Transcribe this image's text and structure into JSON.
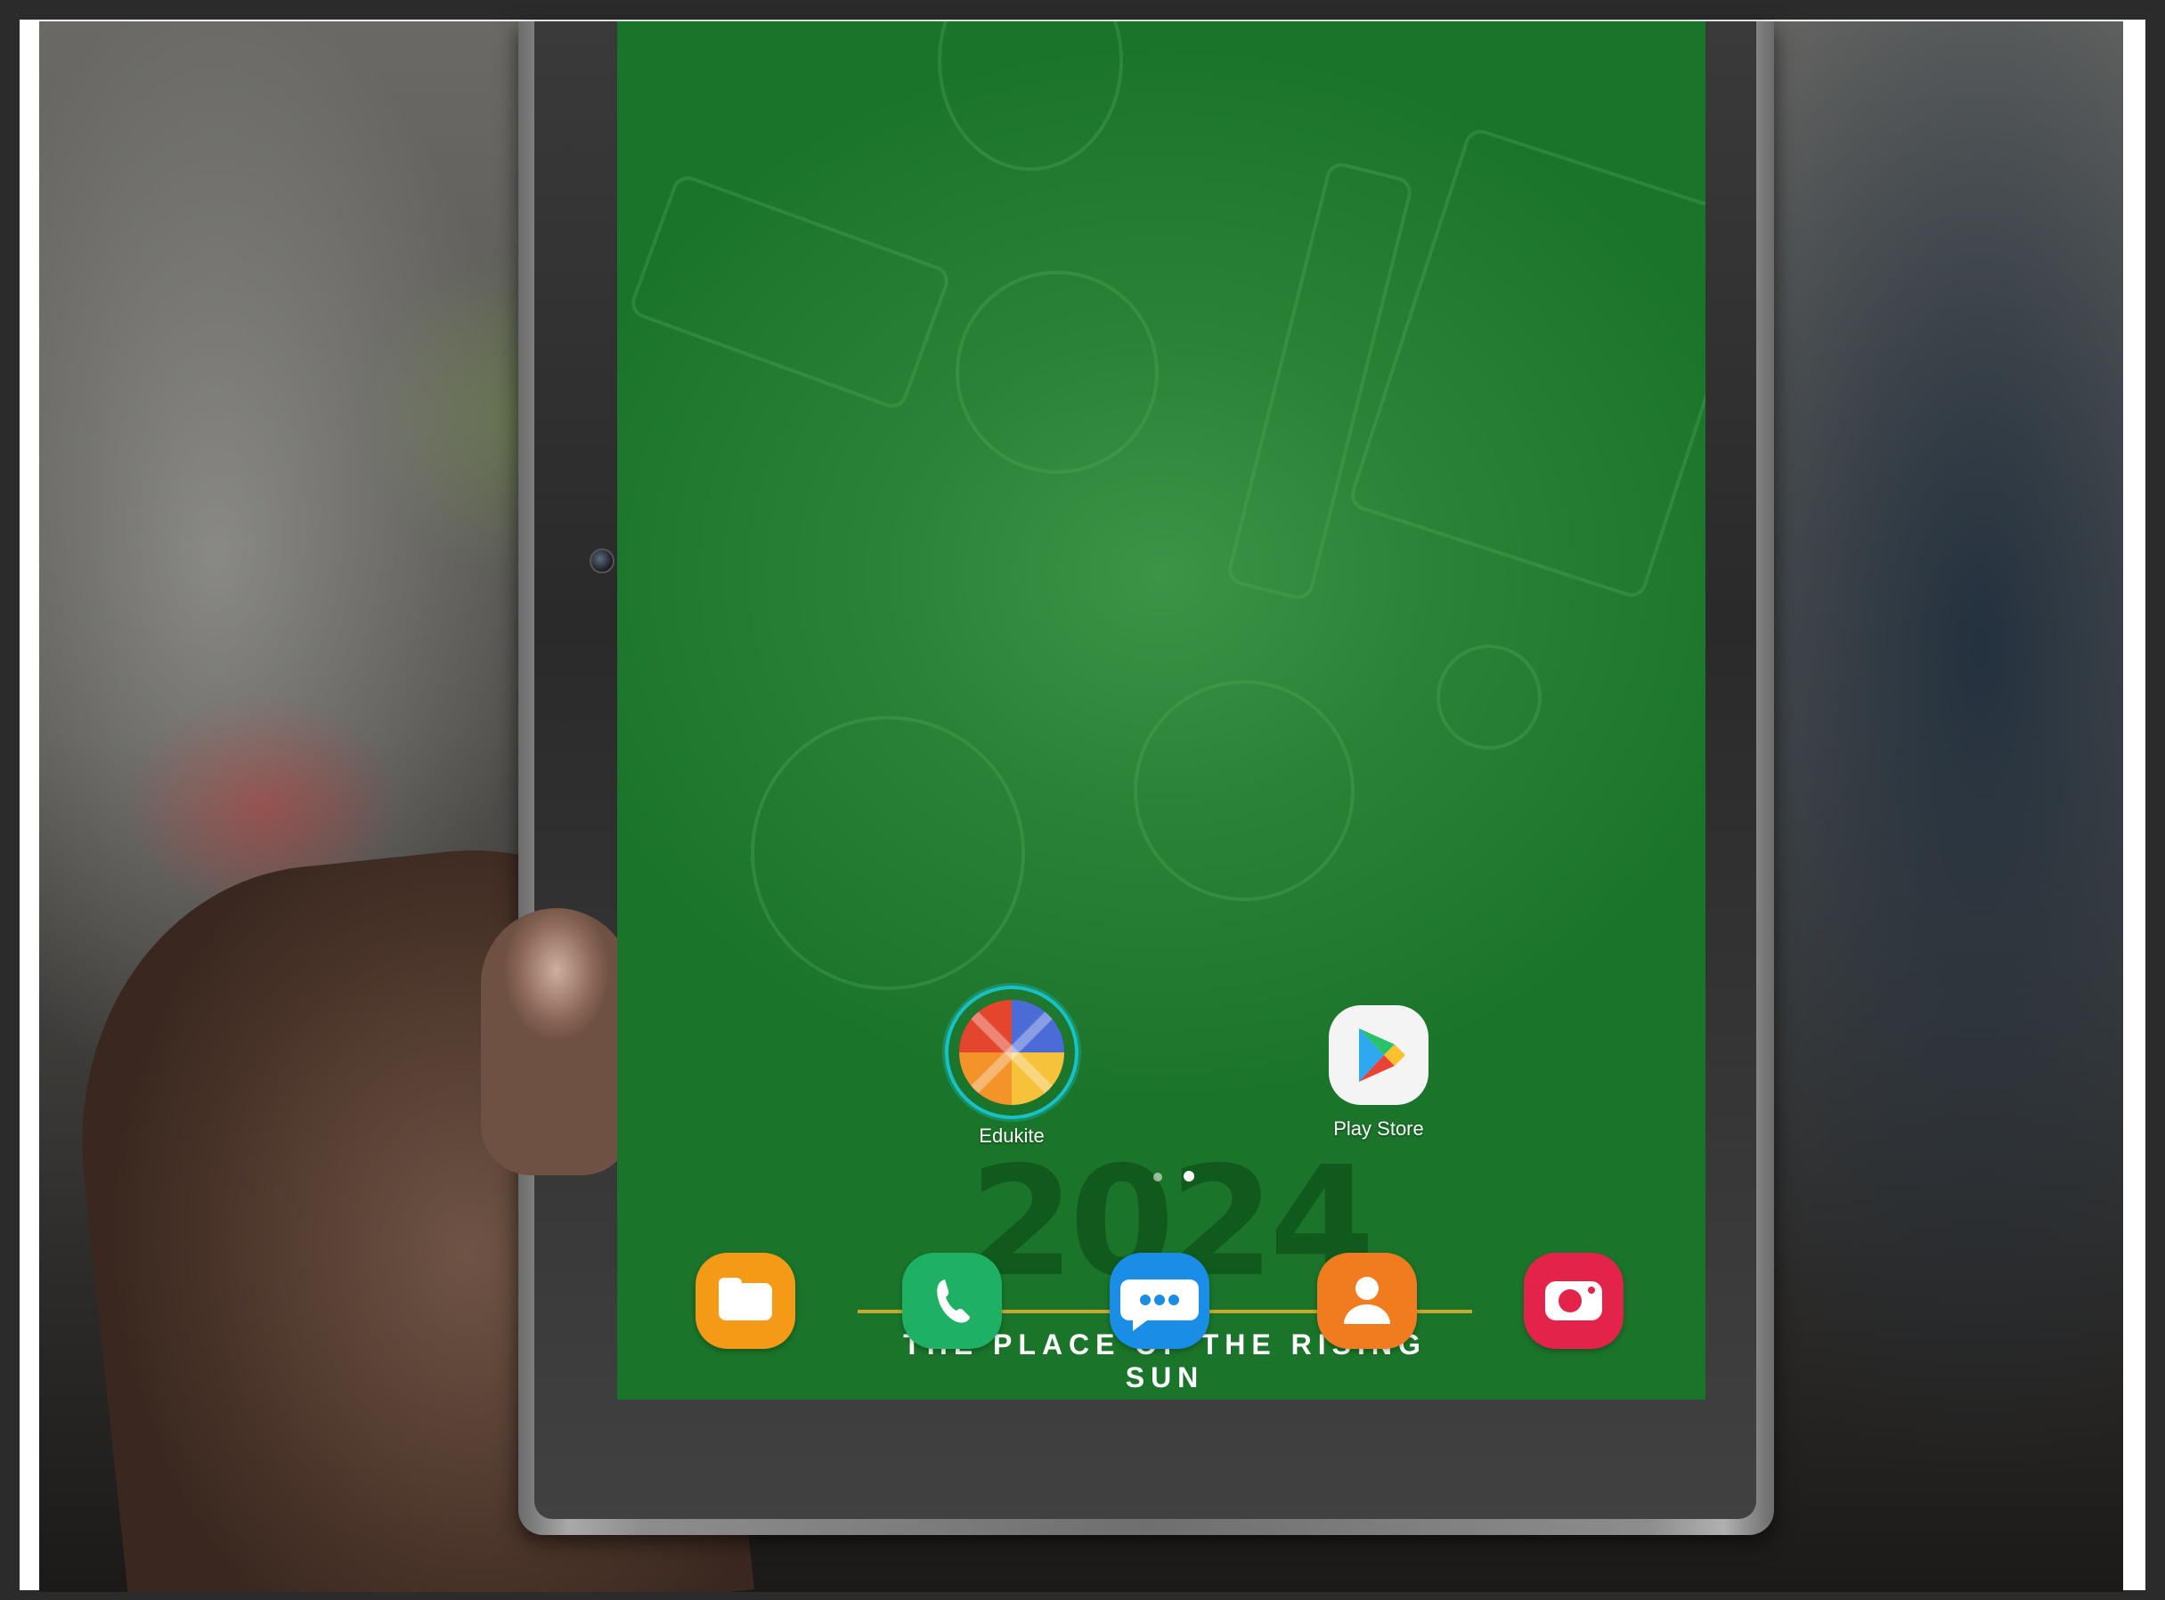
{
  "home_screen": {
    "apps": [
      {
        "label": "Edukite",
        "icon": "edukite-icon"
      },
      {
        "label": "Play Store",
        "icon": "play-store-icon"
      }
    ],
    "page_indicator": {
      "pages": 2,
      "active": 2
    },
    "wallpaper": {
      "year": "2024",
      "slogan": "THE PLACE OF THE RISING SUN",
      "accent": "#c8a92c",
      "background": "#2a8237"
    }
  },
  "dock": [
    {
      "name": "my-files-icon",
      "color": "#f59a17"
    },
    {
      "name": "phone-icon",
      "color": "#1eb063"
    },
    {
      "name": "messages-icon",
      "color": "#1a8ee6"
    },
    {
      "name": "contacts-icon",
      "color": "#f17b1f"
    },
    {
      "name": "camera-icon",
      "color": "#e4234a"
    }
  ],
  "navigation_bar": {
    "recents": "|||",
    "home": "▢",
    "back": "‹"
  }
}
